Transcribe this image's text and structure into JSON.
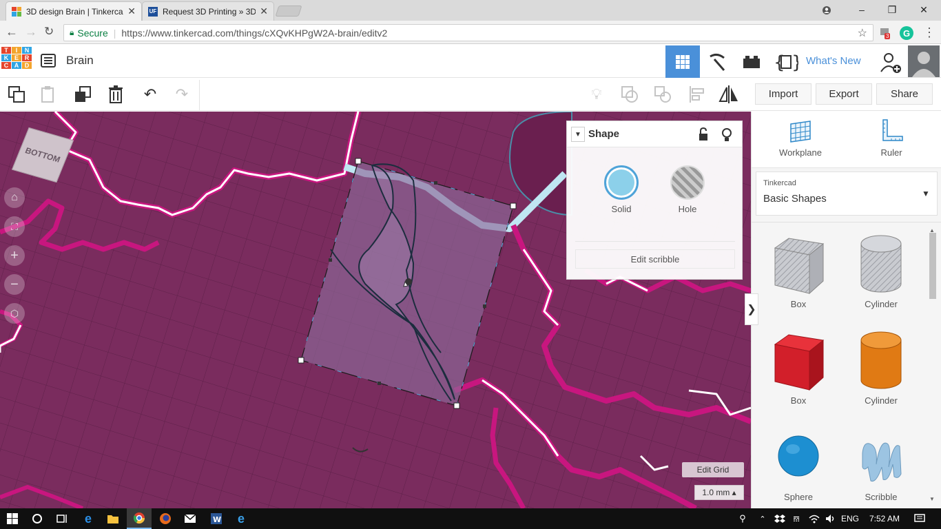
{
  "browser": {
    "tabs": [
      {
        "title": "3D design Brain | Tinkerca",
        "close": "✕",
        "favicon": "tinkercad-icon"
      },
      {
        "title": "Request 3D Printing » 3D",
        "close": "✕",
        "favicon": "uf-icon"
      }
    ],
    "window_controls": {
      "minimize": "–",
      "restore": "❐",
      "close": "✕"
    },
    "secure_label": "Secure",
    "url": "https://www.tinkercad.com/things/cXQvKHPgW2A-brain/editv2",
    "extension_badge": "3"
  },
  "app": {
    "logo_letters": [
      "T",
      "I",
      "N",
      "K",
      "E",
      "R",
      "C",
      "A",
      "D",
      "",
      "",
      ""
    ],
    "logo_colors": [
      "#e5452c",
      "#f3a52d",
      "#2fa5e4",
      "#2fa5e4",
      "#f3a52d",
      "#e5452c",
      "#e5452c",
      "#2fa5e4",
      "#f3a52d",
      "#ffffff",
      "#ffffff",
      "#ffffff"
    ],
    "design_title": "Brain",
    "whats_new": "What's New",
    "toolbar": {
      "import": "Import",
      "export": "Export",
      "share": "Share"
    }
  },
  "canvas": {
    "view_cube_label": "BOTTOM",
    "edit_grid": "Edit Grid",
    "snap_grid": "1.0 mm ▴"
  },
  "inspector": {
    "title": "Shape",
    "solid_label": "Solid",
    "hole_label": "Hole",
    "edit_scribble": "Edit scribble"
  },
  "right_panel": {
    "workplane": "Workplane",
    "ruler": "Ruler",
    "library_group": "Tinkercad",
    "library_name": "Basic Shapes",
    "collapse_arrow": "❯",
    "shapes": [
      {
        "label": "Box",
        "color": "#b9bcc4"
      },
      {
        "label": "Cylinder",
        "color": "#b9bcc4"
      },
      {
        "label": "Box",
        "color": "#d21f2a"
      },
      {
        "label": "Cylinder",
        "color": "#e07a14"
      },
      {
        "label": "Sphere",
        "color": "#1d8fd1"
      },
      {
        "label": "Scribble",
        "color": "#9cc4e2"
      }
    ]
  },
  "taskbar": {
    "language": "ENG",
    "time": "7:52 AM"
  }
}
